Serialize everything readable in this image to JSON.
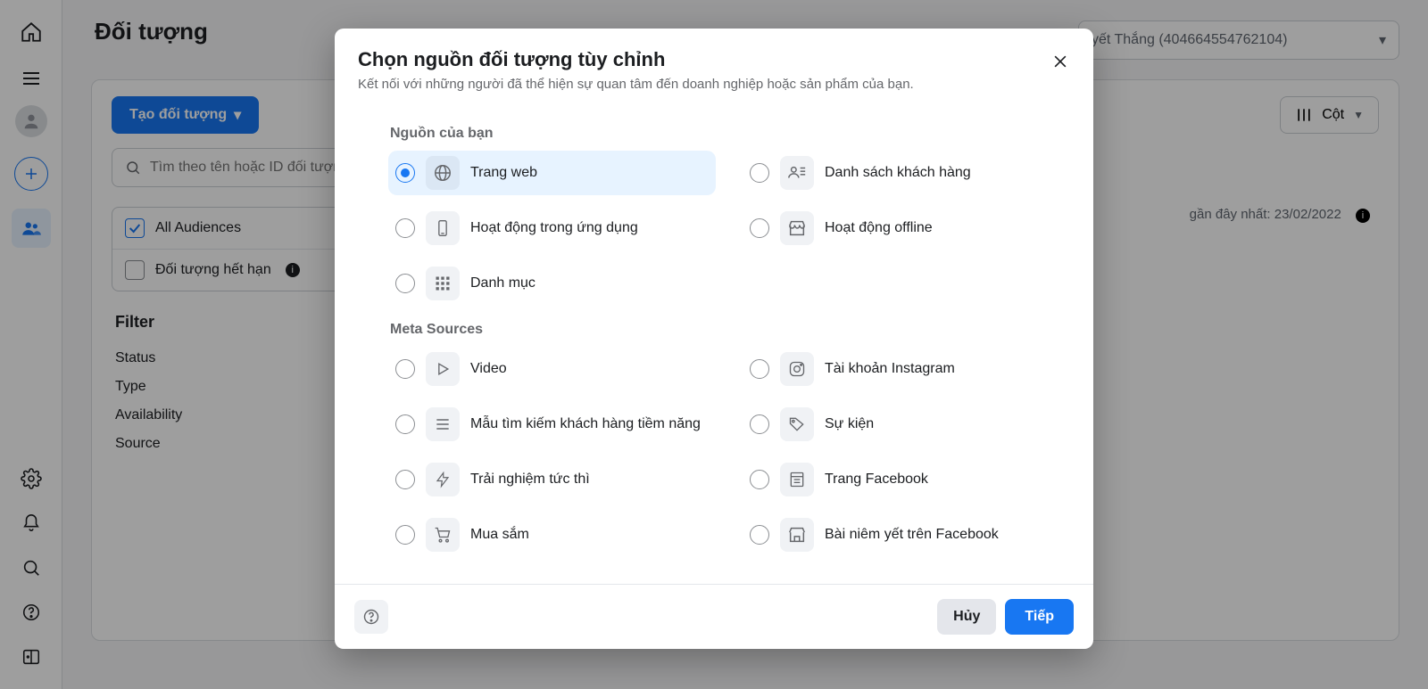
{
  "page": {
    "title": "Đối tượng",
    "account": "yết Thắng (404664554762104)",
    "create_button": "Tạo đối tượng",
    "columns_button": "Cột",
    "search_placeholder": "Tìm theo tên hoặc ID đối tượng",
    "audiences": {
      "all": "All Audiences",
      "expired": "Đối tượng hết hạn"
    },
    "filter": {
      "heading": "Filter",
      "items": [
        "Status",
        "Type",
        "Availability",
        "Source"
      ]
    },
    "last_updated_label": "gần đây nhất:",
    "last_updated_value": "23/02/2022"
  },
  "dialog": {
    "title": "Chọn nguồn đối tượng tùy chỉnh",
    "subtitle": "Kết nối với những người đã thể hiện sự quan tâm đến doanh nghiệp hoặc sản phẩm của bạn.",
    "sections": {
      "your_sources": "Nguồn của bạn",
      "meta_sources": "Meta Sources"
    },
    "your_sources": [
      {
        "id": "website",
        "label": "Trang web",
        "selected": true
      },
      {
        "id": "customer_list",
        "label": "Danh sách khách hàng",
        "selected": false
      },
      {
        "id": "app_activity",
        "label": "Hoạt động trong ứng dụng",
        "selected": false
      },
      {
        "id": "offline",
        "label": "Hoạt động offline",
        "selected": false
      },
      {
        "id": "catalog",
        "label": "Danh mục",
        "selected": false
      }
    ],
    "meta_sources": [
      {
        "id": "video",
        "label": "Video"
      },
      {
        "id": "instagram",
        "label": "Tài khoản Instagram"
      },
      {
        "id": "lead_form",
        "label": "Mẫu tìm kiếm khách hàng tiềm năng"
      },
      {
        "id": "events",
        "label": "Sự kiện"
      },
      {
        "id": "instant_exp",
        "label": "Trải nghiệm tức thì"
      },
      {
        "id": "fb_page",
        "label": "Trang Facebook"
      },
      {
        "id": "shopping",
        "label": "Mua sắm"
      },
      {
        "id": "fb_listings",
        "label": "Bài niêm yết trên Facebook"
      }
    ],
    "footer": {
      "cancel": "Hủy",
      "next": "Tiếp"
    }
  }
}
